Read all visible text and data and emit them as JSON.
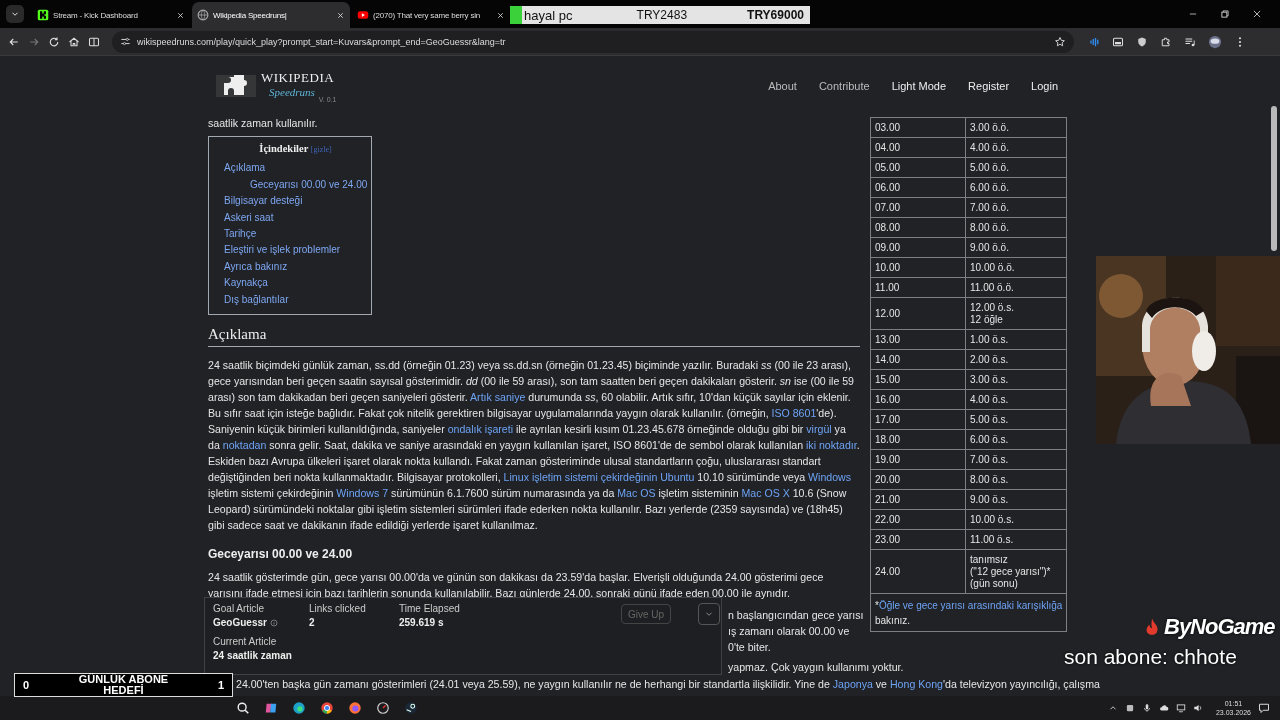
{
  "browser": {
    "tabs": [
      {
        "title": "Stream - Kick Dashboard",
        "selected": false
      },
      {
        "title": "Wikipedia Speedruns|",
        "selected": true
      },
      {
        "title": "(2070) That very same berry sin",
        "selected": false
      }
    ],
    "url": "wikispeedruns.com/play/quick_play?prompt_start=Kuvars&prompt_end=GeoGuessr&lang=tr"
  },
  "donation_bar": {
    "label": "hayal pc",
    "current": "TRY2483",
    "goal": "TRY69000",
    "level": 0.04
  },
  "site": {
    "logo_title": "WIKIPEDIA",
    "logo_subtitle": "Speedruns",
    "version": "V. 0.1",
    "nav": [
      "About",
      "Contribute",
      "Light Mode",
      "Register",
      "Login"
    ]
  },
  "article": {
    "intro": "saatlik zaman kullanılır.",
    "toc": {
      "title": "İçindekiler",
      "toggle": "[gizle]",
      "items": [
        {
          "label": "Açıklama",
          "children": [
            {
              "label": "Geceyarısı 00.00 ve 24.00"
            }
          ]
        },
        {
          "label": "Bilgisayar desteği"
        },
        {
          "label": "Askeri saat"
        },
        {
          "label": "Tarihçe"
        },
        {
          "label": "Eleştiri ve işlek problemler"
        },
        {
          "label": "Ayrıca bakınız"
        },
        {
          "label": "Kaynakça"
        },
        {
          "label": "Dış bağlantılar"
        }
      ]
    },
    "sections": [
      {
        "heading": "Açıklama",
        "kind": "h2",
        "paragraphs": [
          [
            {
              "kind": "text",
              "text": "24 saatlik biçimdeki günlük zaman, ss.dd (örneğin 01.23) veya ss.dd.sn (örneğin 01.23.45) biçiminde yazılır. Buradaki *ss* (00 ile 23 arası), gece yarısından beri geçen saatin sayısal gösterimidir. *dd* (00 ile 59 arası), son tam saatten beri geçen dakikaları gösterir. *sn* ise (00 ile 59 arası) son tam dakikadan beri geçen saniyeleri gösterir. "
            },
            {
              "kind": "link",
              "text": "Artık saniye"
            },
            {
              "kind": "text",
              "text": " durumunda *ss*, 60 olabilir. Artık sıfır, 10'dan küçük sayılar için eklenir. Bu sıfır saat için isteğe bağlıdır. Fakat çok nitelik gerektiren bilgisayar uygulamalarında yaygın olarak kullanılır. (örneğin, "
            },
            {
              "kind": "link",
              "text": "ISO 8601"
            },
            {
              "kind": "text",
              "text": "'de). Saniyenin küçük birimleri kullanıldığında, saniyeler "
            },
            {
              "kind": "link",
              "text": "ondalık işareti"
            },
            {
              "kind": "text",
              "text": " ile ayrılan kesirli kısım 01.23.45.678 örneğinde olduğu gibi bir "
            },
            {
              "kind": "link",
              "text": "virgül"
            },
            {
              "kind": "text",
              "text": " ya da "
            },
            {
              "kind": "link",
              "text": "noktadan"
            },
            {
              "kind": "text",
              "text": " sonra gelir. Saat, dakika ve saniye arasındaki en yaygın kullanılan işaret, ISO 8601'de de sembol olarak kullanılan "
            },
            {
              "kind": "link",
              "text": "iki noktadır"
            },
            {
              "kind": "text",
              "text": ". Eskiden bazı Avrupa ülkeleri işaret olarak nokta kullandı. Fakat zaman gösteriminde ulusal standartların çoğu, uluslararası standart değiştiğinden beri nokta kullanmaktadır. Bilgisayar protokolleri, "
            },
            {
              "kind": "link",
              "text": "Linux işletim sistemi çekirdeğinin Ubuntu"
            },
            {
              "kind": "text",
              "text": " 10.10 sürümünde veya "
            },
            {
              "kind": "link",
              "text": "Windows"
            },
            {
              "kind": "text",
              "text": " işletim sistemi çekirdeğinin "
            },
            {
              "kind": "link",
              "text": "Windows 7"
            },
            {
              "kind": "text",
              "text": " sürümünün 6.1.7600 sürüm numarasında ya da "
            },
            {
              "kind": "link",
              "text": "Mac OS"
            },
            {
              "kind": "text",
              "text": " işletim sisteminin "
            },
            {
              "kind": "link",
              "text": "Mac OS X"
            },
            {
              "kind": "text",
              "text": " 10.6 (Snow Leopard) sürümündeki noktalar gibi işletim sistemleri sürümleri ifade ederken nokta kullanılır. Bazı yerlerde (2359 sayısında) ve (18h45) gibi sadece saat ve dakikanın ifade edildiği yerlerde işaret kullanılmaz."
            }
          ]
        ]
      },
      {
        "heading": "Geceyarısı 00.00 ve 24.00",
        "kind": "h3",
        "paragraphs": [
          [
            {
              "kind": "text",
              "text": "24 saatlik gösterimde gün, gece yarısı 00.00'da ve günün son dakikası da 23.59'da başlar. Elverişli olduğunda 24.00 gösterimi gece yarısını ifade etmesi için bazı tarihlerin sonunda kullanılabilir. Bazı günlerde 24.00, sonraki günü ifade eden 00.00 ile aynıdır."
            }
          ]
        ]
      }
    ],
    "covered_fragments": [
      "n başlangıcından gece yarısı",
      "ış zamanı olarak 00.00 ve",
      "0'te biter.",
      "yapmaz. Çok yaygın kullanımı yoktur."
    ],
    "last_line": [
      {
        "kind": "text",
        "text": "24.00'ten başka gün zamanı gösterimleri (24.01 veya 25.59), ne yaygın kullanılır ne de herhangi bir standartla ilişkilidir. Yine de "
      },
      {
        "kind": "link",
        "text": "Japonya"
      },
      {
        "kind": "text",
        "text": " ve "
      },
      {
        "kind": "link",
        "text": "Hong Kong"
      },
      {
        "kind": "text",
        "text": "'da televizyon yayıncılığı, çalışma"
      }
    ]
  },
  "time_table": {
    "rows": [
      {
        "h24": "03.00",
        "h12": "3.00 ö.ö."
      },
      {
        "h24": "04.00",
        "h12": "4.00 ö.ö."
      },
      {
        "h24": "05.00",
        "h12": "5.00 ö.ö."
      },
      {
        "h24": "06.00",
        "h12": "6.00 ö.ö."
      },
      {
        "h24": "07.00",
        "h12": "7.00 ö.ö."
      },
      {
        "h24": "08.00",
        "h12": "8.00 ö.ö."
      },
      {
        "h24": "09.00",
        "h12": "9.00 ö.ö."
      },
      {
        "h24": "10.00",
        "h12": "10.00 ö.ö."
      },
      {
        "h24": "11.00",
        "h12": "11.00 ö.ö."
      },
      {
        "h24": "12.00",
        "h12": "12.00 ö.s.\n12 öğle"
      },
      {
        "h24": "13.00",
        "h12": "1.00 ö.s."
      },
      {
        "h24": "14.00",
        "h12": "2.00 ö.s."
      },
      {
        "h24": "15.00",
        "h12": "3.00 ö.s."
      },
      {
        "h24": "16.00",
        "h12": "4.00 ö.s."
      },
      {
        "h24": "17.00",
        "h12": "5.00 ö.s."
      },
      {
        "h24": "18.00",
        "h12": "6.00 ö.s."
      },
      {
        "h24": "19.00",
        "h12": "7.00 ö.s."
      },
      {
        "h24": "20.00",
        "h12": "8.00 ö.s."
      },
      {
        "h24": "21.00",
        "h12": "9.00 ö.s."
      },
      {
        "h24": "22.00",
        "h12": "10.00 ö.s."
      },
      {
        "h24": "23.00",
        "h12": "11.00 ö.s."
      },
      {
        "h24": "24.00",
        "h12": "tanımsız\n(\"12 gece yarısı\")*\n(gün sonu)"
      }
    ],
    "footnote": [
      {
        "kind": "text",
        "text": "*"
      },
      {
        "kind": "link",
        "text": "Öğle ve gece yarısı arasındaki karışıklığa"
      },
      {
        "kind": "text",
        "text": " bakınız."
      }
    ]
  },
  "game_panel": {
    "stats": [
      {
        "label": "Goal Article",
        "value": "GeoGuessr",
        "info": true
      },
      {
        "label": "Links clicked",
        "value": "2",
        "info": false
      },
      {
        "label": "Time Elapsed",
        "value": "259.619 s",
        "info": false
      }
    ],
    "current": {
      "label": "Current Article",
      "value": "24 saatlik zaman"
    },
    "give_up": {
      "label": "Give Up",
      "disabled": true
    }
  },
  "stream_overlay": {
    "goal_current": "0",
    "goal_title": "GÜNLÜK ABONE HEDEFİ",
    "goal_target": "1",
    "brand": "ByNoGame",
    "last_sub": "son abone: chhote"
  },
  "taskbar": {
    "time": "01:51",
    "date": "23.03.2026"
  }
}
